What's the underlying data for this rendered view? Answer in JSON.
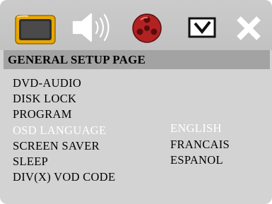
{
  "tabs": [
    {
      "icon": "general-setup-tv-icon",
      "active": true
    },
    {
      "icon": "audio-speaker-icon",
      "active": false
    },
    {
      "icon": "video-reel-icon",
      "active": false
    },
    {
      "icon": "preference-checkbox-icon",
      "active": false
    },
    {
      "icon": "exit-x-icon",
      "active": false
    }
  ],
  "header": {
    "title": "GENERAL SETUP PAGE"
  },
  "menu": {
    "items": [
      {
        "label": "DVD-AUDIO"
      },
      {
        "label": "DISK LOCK"
      },
      {
        "label": "PROGRAM"
      },
      {
        "label": "OSD LANGUAGE",
        "selected": true
      },
      {
        "label": "SCREEN SAVER"
      },
      {
        "label": "SLEEP"
      },
      {
        "label": "DIV(X) VOD CODE"
      }
    ]
  },
  "options": {
    "items": [
      {
        "label": "ENGLISH",
        "selected": true
      },
      {
        "label": "FRANCAIS"
      },
      {
        "label": "ESPANOL"
      }
    ]
  },
  "colors": {
    "background": "#d3d3d3",
    "header_bar": "#a3a3a3",
    "highlight_text": "#ffffff",
    "reel_red": "#b22222",
    "tv_orange": "#e8a800"
  }
}
